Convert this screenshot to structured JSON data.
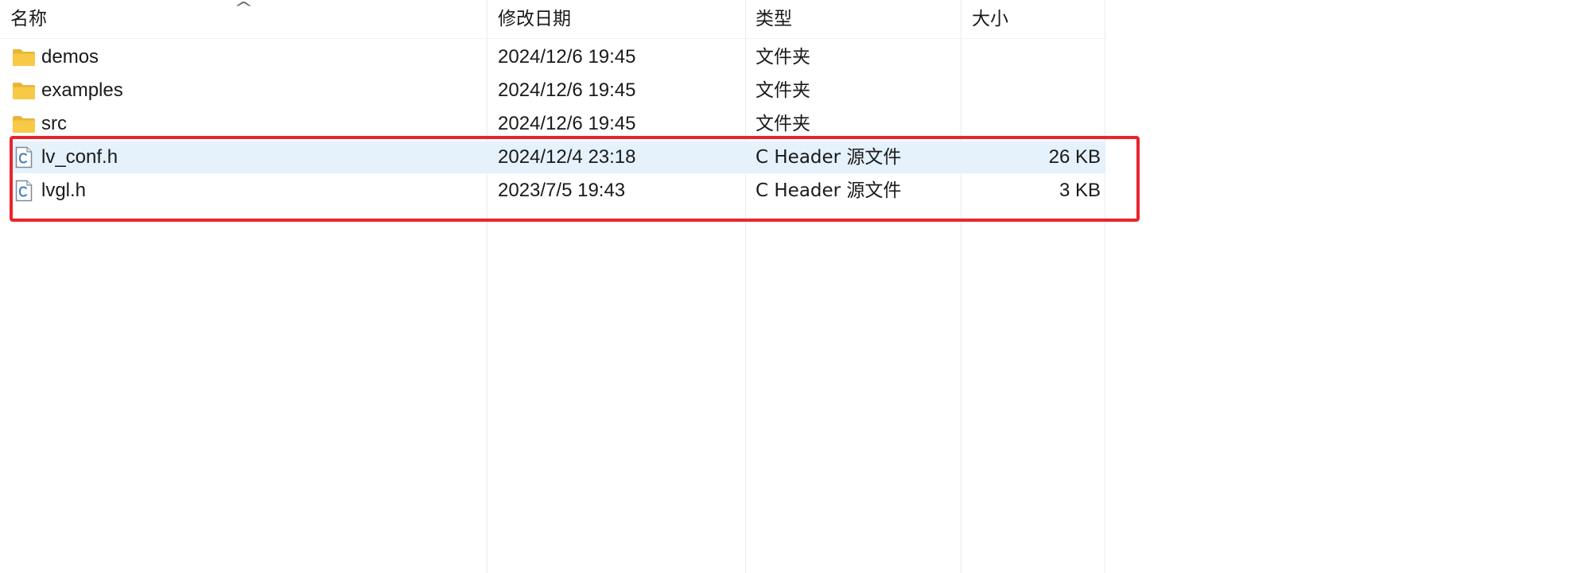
{
  "columns": {
    "name": "名称",
    "date": "修改日期",
    "type": "类型",
    "size": "大小"
  },
  "sort": {
    "column": "name",
    "direction_icon": "chevron-up-icon",
    "glyph": "^"
  },
  "files": [
    {
      "name": "demos",
      "date": "2024/12/6 19:45",
      "type": "文件夹",
      "size": "",
      "icon": "folder-icon"
    },
    {
      "name": "examples",
      "date": "2024/12/6 19:45",
      "type": "文件夹",
      "size": "",
      "icon": "folder-icon"
    },
    {
      "name": "src",
      "date": "2024/12/6 19:45",
      "type": "文件夹",
      "size": "",
      "icon": "folder-icon"
    },
    {
      "name": "lv_conf.h",
      "date": "2024/12/4 23:18",
      "type": "C Header 源文件",
      "size": "26 KB",
      "icon": "c-header-file-icon",
      "selected": true
    },
    {
      "name": "lvgl.h",
      "date": "2023/7/5 19:43",
      "type": "C Header 源文件",
      "size": "3 KB",
      "icon": "c-header-file-icon"
    }
  ],
  "colors": {
    "selection": "#e5f1fb",
    "highlight_box": "#e8252b",
    "folder": "#f8c847"
  }
}
